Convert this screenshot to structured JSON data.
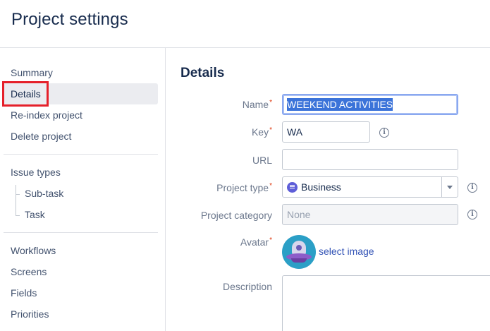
{
  "header": {
    "title": "Project settings"
  },
  "sidebar": {
    "items": [
      {
        "label": "Summary"
      },
      {
        "label": "Details"
      },
      {
        "label": "Re-index project"
      },
      {
        "label": "Delete project"
      },
      {
        "label": "Issue types"
      },
      {
        "label": "Sub-task"
      },
      {
        "label": "Task"
      },
      {
        "label": "Workflows"
      },
      {
        "label": "Screens"
      },
      {
        "label": "Fields"
      },
      {
        "label": "Priorities"
      }
    ],
    "selected": "Details"
  },
  "details": {
    "title": "Details",
    "name_label": "Name",
    "name_value": "WEEKEND ACTIVITIES",
    "key_label": "Key",
    "key_value": "WA",
    "url_label": "URL",
    "url_value": "",
    "project_type_label": "Project type",
    "project_type_value": "Business",
    "project_category_label": "Project category",
    "project_category_value": "None",
    "avatar_label": "Avatar",
    "select_image_label": "select image",
    "description_label": "Description",
    "required_marker": "*",
    "info_glyph": "i"
  },
  "colors": {
    "required": "#de350b",
    "link": "#3051b5",
    "selected_nav_bg": "#ebecf0",
    "annotation_box": "#e5202a",
    "business_icon": "#5e5ed8"
  },
  "icons": {
    "info": "info-icon",
    "business": "business-project-icon",
    "dropdown": "chevron-down-icon",
    "avatar": "ufo-avatar"
  }
}
